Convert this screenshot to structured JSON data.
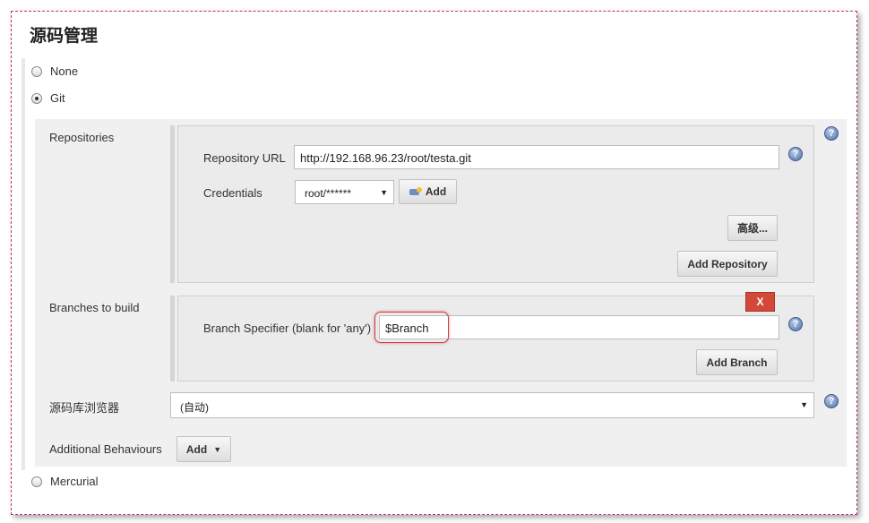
{
  "section": {
    "title": "源码管理"
  },
  "scm_options": {
    "none_label": "None",
    "git_label": "Git",
    "mercurial_label": "Mercurial",
    "selected": "Git"
  },
  "repositories": {
    "label": "Repositories",
    "url_label": "Repository URL",
    "url_value": "http://192.168.96.23/root/testa.git",
    "credentials_label": "Credentials",
    "credentials_value": "root/******",
    "add_credentials_label": "Add",
    "advanced_label": "高级...",
    "add_repository_label": "Add Repository"
  },
  "branches": {
    "label": "Branches to build",
    "delete_label": "X",
    "specifier_label": "Branch Specifier (blank for 'any')",
    "specifier_value": "$Branch",
    "add_branch_label": "Add Branch"
  },
  "browser": {
    "label": "源码库浏览器",
    "value": "(自动)"
  },
  "behaviours": {
    "label": "Additional Behaviours",
    "add_label": "Add"
  },
  "icons": {
    "help": "help-icon",
    "dropdown": "chevron-down-icon",
    "credentials": "credentials-add-icon"
  },
  "colors": {
    "delete_button": "#d24939",
    "highlight": "#d23c3c",
    "help_icon": "#4b6fa8",
    "frame_border": "#c0307a"
  }
}
